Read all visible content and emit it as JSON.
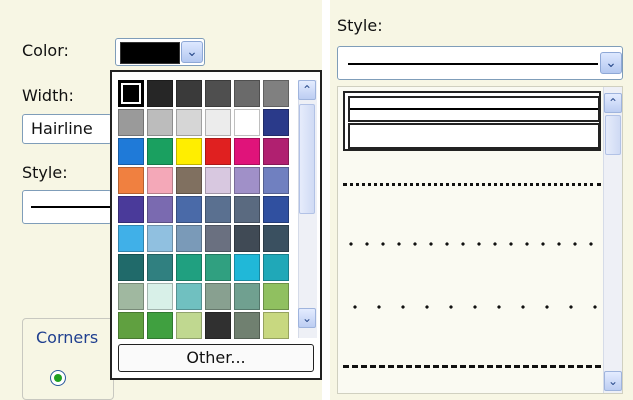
{
  "left": {
    "color_label": "Color:",
    "width_label": "Width:",
    "width_value": "Hairline",
    "style_label": "Style:",
    "corners_label": "Corners",
    "palette": {
      "selected_color": "#000000",
      "other_button_label": "Other...",
      "swatches": [
        [
          "#000000",
          "#262626",
          "#3a3a3a",
          "#4f4f4f",
          "#6a6a6a",
          "#808080"
        ],
        [
          "#9a9a9a",
          "#bcbcbc",
          "#d6d6d6",
          "#ececec",
          "#ffffff",
          "#2a3a8a"
        ],
        [
          "#1f7ad8",
          "#1aa060",
          "#ffee00",
          "#e02020",
          "#e0137a",
          "#b02070"
        ],
        [
          "#f08040",
          "#f4a8b8",
          "#807060",
          "#d8c8e0",
          "#a090c8",
          "#7080c0"
        ],
        [
          "#4a3a9a",
          "#7a6ab0",
          "#4a6aa8",
          "#5a7090",
          "#5a6a80",
          "#3050a0"
        ],
        [
          "#40b0e8",
          "#90c0e0",
          "#7a9ab8",
          "#6a7080",
          "#404a55",
          "#3a5060"
        ],
        [
          "#206a6a",
          "#308080",
          "#20a080",
          "#30a080",
          "#20b8d8",
          "#20a8b8"
        ],
        [
          "#a0b8a0",
          "#d8f0e8",
          "#70c0c0",
          "#88a090",
          "#70a090",
          "#90c060"
        ],
        [
          "#60a040",
          "#40a040",
          "#c0d890",
          "#303030",
          "#708070",
          "#c8d880"
        ]
      ]
    }
  },
  "right": {
    "style_label": "Style:",
    "line_styles": [
      "solid",
      "solid-thick",
      "dense-dotted",
      "dotted",
      "sparse-dotted",
      "dashed"
    ],
    "selected_style": "solid"
  }
}
